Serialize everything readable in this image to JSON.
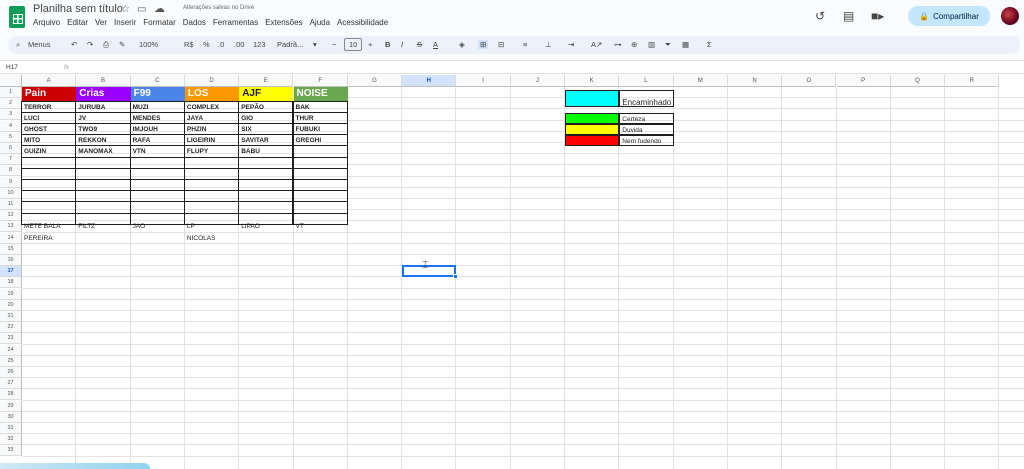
{
  "app": {
    "title": "Planilha sem título",
    "save_status": "Alterações salvas no Drive",
    "share_label": "Compartilhar"
  },
  "menu": [
    "Arquivo",
    "Editar",
    "Ver",
    "Inserir",
    "Formatar",
    "Dados",
    "Ferramentas",
    "Extensões",
    "Ajuda",
    "Acessibilidade"
  ],
  "toolbar": {
    "search_label": "Menus",
    "zoom": "100%",
    "currency": "R$",
    "percent": "%",
    "dec_less": ".0",
    "dec_more": ".00",
    "number_format": "123",
    "font_name": "Padrã...",
    "font_size": "10"
  },
  "formula_bar": {
    "cell_ref": "H17",
    "fx": "fx"
  },
  "columns": [
    "A",
    "B",
    "C",
    "D",
    "E",
    "F",
    "G",
    "H",
    "I",
    "J",
    "K",
    "L",
    "M",
    "N",
    "O",
    "P",
    "Q",
    "R"
  ],
  "selected_column": "H",
  "selected_row": "17",
  "rows": [
    "1",
    "2",
    "3",
    "4",
    "5",
    "6",
    "7",
    "8",
    "9",
    "10",
    "11",
    "12",
    "13",
    "14",
    "15",
    "16",
    "17",
    "18",
    "19",
    "20",
    "21",
    "22",
    "23",
    "24",
    "25",
    "26",
    "27",
    "28",
    "29",
    "30",
    "31",
    "32",
    "33"
  ],
  "teams": [
    {
      "name": "Pain",
      "color": "#cc0000",
      "text_color": "#ffffff",
      "players": [
        "TERROR",
        "LUCI",
        "GHOST",
        "MITO",
        "GUIZIN"
      ],
      "extra": [
        "METE BALA",
        "PEREIRA"
      ]
    },
    {
      "name": "Crias",
      "color": "#9900ff",
      "text_color": "#ffffff",
      "players": [
        "JURUBA",
        "JV",
        "TWO9",
        "REKKON",
        "MANOMAX"
      ],
      "extra": [
        "FILTZ",
        ""
      ]
    },
    {
      "name": "F99",
      "color": "#4a86e8",
      "text_color": "#ffffff",
      "players": [
        "MUZI",
        "MENDES",
        "IMJOUH",
        "RAFA",
        "VTN"
      ],
      "extra": [
        "JAO",
        ""
      ]
    },
    {
      "name": "LOS",
      "color": "#ff9900",
      "text_color": "#ffffff",
      "players": [
        "COMPLEX",
        "JAYA",
        "PHZIN",
        "LIGEIRIN",
        "FLUPY"
      ],
      "extra": [
        "LP",
        "NICOLAS"
      ]
    },
    {
      "name": "AJF",
      "color": "#ffff00",
      "text_color": "#1f1f1f",
      "players": [
        "PEPÃO",
        "GIO",
        "SIX",
        "SAVITAR",
        "BABU"
      ],
      "extra": [
        "LIPAO",
        ""
      ]
    },
    {
      "name": "NOISE",
      "color": "#6aa84f",
      "text_color": "#ffffff",
      "players": [
        "BAK",
        "THUR",
        "FUBUKI",
        "GREGHI",
        ""
      ],
      "extra": [
        "VT",
        ""
      ]
    }
  ],
  "legend": [
    {
      "color": "#00ffff",
      "label": "Encaminhado"
    },
    {
      "color": "#00ff00",
      "label": "Certeza"
    },
    {
      "color": "#ffff00",
      "label": "Duvida"
    },
    {
      "color": "#ff0000",
      "label": "Nem fudendo"
    }
  ]
}
